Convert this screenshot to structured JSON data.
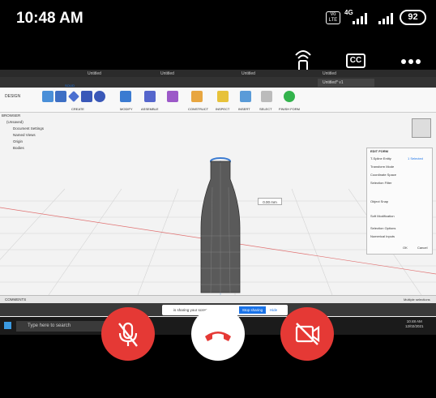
{
  "status": {
    "time": "10:48 AM",
    "volte": "Vo LTE",
    "network": "4G",
    "battery": "92"
  },
  "call_controls": {
    "cast_icon": "cast-icon",
    "cc_label": "CC",
    "more_icon": "more-icon"
  },
  "screen": {
    "browser_tabs": [
      "Untitled",
      "Untitled",
      "Untitled",
      "Untitled"
    ],
    "app_tab": "Untitled* v1",
    "ribbon": {
      "design_label": "DESIGN",
      "solid_tab": "SOLID",
      "groups": [
        "CREATE",
        "MODIFY",
        "ASSEMBLE",
        "CONSTRUCT",
        "INSPECT",
        "INSERT",
        "SELECT",
        "FINISH FORM"
      ]
    },
    "browser_items": [
      "BROWSER",
      "(Unsaved)",
      "Document Settings",
      "Named Views",
      "Origin",
      "Bodies"
    ],
    "edit_form": {
      "title": "EDIT FORM",
      "rows": [
        "T-Spline Entity",
        "Transform Mode",
        "Coordinate Space",
        "Selection Filter",
        "Object Snap",
        "Soft Modification",
        "Selection Options",
        "Numerical Inputs"
      ],
      "entity_value": "1 Selected",
      "ok": "OK",
      "cancel": "Cancel"
    },
    "dimension_value": "0.00 mm",
    "comments_label": "COMMENTS",
    "multiple_selections": "Multiple selections",
    "toast_text": "is sharing your screen",
    "toast_stop": "Stop sharing",
    "toast_hide": "Hide",
    "taskbar_search": "Type here to search",
    "taskbar_time": "10:48 AM",
    "taskbar_date": "12/02/2021"
  },
  "colors": {
    "end_call": "#ffffff",
    "end_call_icon": "#e53935",
    "mute": "#e53935",
    "video": "#e53935"
  },
  "buttons": {
    "mute_icon": "mic-off-icon",
    "end_icon": "end-call-icon",
    "video_icon": "video-off-icon"
  }
}
